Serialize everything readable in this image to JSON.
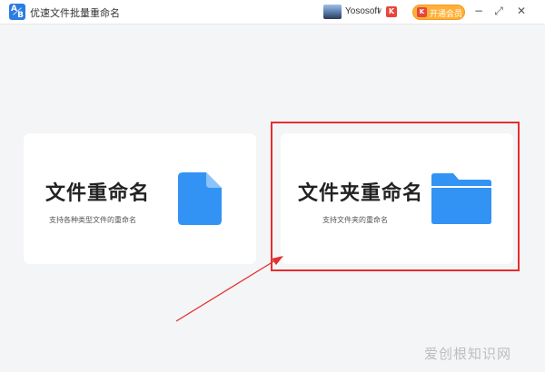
{
  "app": {
    "title": "优速文件批量重命名",
    "logo_icon": "app-logo-icon"
  },
  "user": {
    "name": "Yososoft",
    "caret": "∨",
    "vip_mark": "K"
  },
  "vip_button": {
    "label": "开通会员",
    "icon": "crown-icon",
    "color": "#ffb03a"
  },
  "window_controls": {
    "minimize": "−",
    "maximize": "⤢",
    "close": "✕"
  },
  "cards": [
    {
      "title": "文件重命名",
      "description": "支持各种类型文件的重命名",
      "icon": "file-icon"
    },
    {
      "title": "文件夹重命名",
      "description": "支持文件夹的重命名",
      "icon": "folder-icon"
    }
  ],
  "colors": {
    "accent": "#3293f5",
    "highlight": "#e62e2e",
    "background": "#f4f5f7"
  },
  "watermark": "爱创根知识网"
}
